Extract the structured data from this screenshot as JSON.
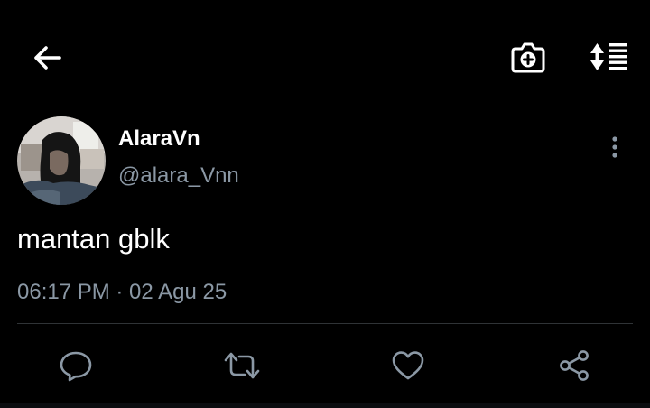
{
  "header": {
    "back_icon": "arrow-left-icon",
    "camera_icon": "camera-plus-icon",
    "sort_icon": "sort-list-icon"
  },
  "tweet": {
    "author": {
      "display_name": "AlaraVn",
      "handle": "@alara_Vnn",
      "avatar_icon": "profile-photo"
    },
    "text": "mantan gblk",
    "timestamp": "06:17 PM · 02 Agu 25",
    "more_icon": "vertical-dots-icon"
  },
  "actions": {
    "reply_icon": "reply-bubble-icon",
    "retweet_icon": "retweet-icon",
    "like_icon": "heart-icon",
    "share_icon": "share-icon"
  },
  "colors": {
    "background": "#000000",
    "primary_text": "#ffffff",
    "secondary_text": "#8b98a5",
    "divider": "#2f3336",
    "icon": "#8b98a5"
  }
}
